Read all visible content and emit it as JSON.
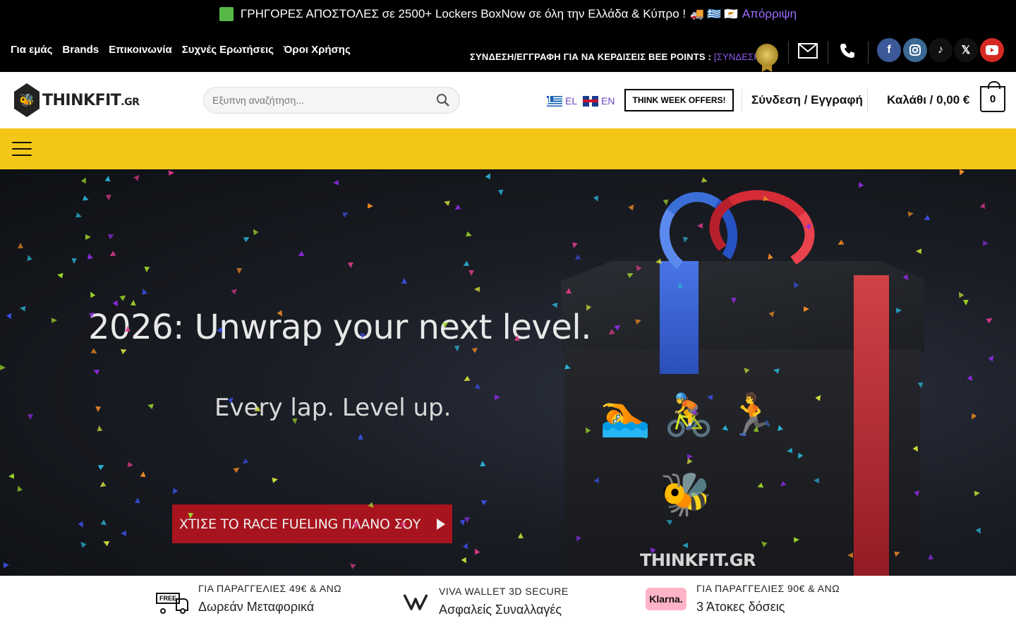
{
  "announcement": {
    "text": "ΓΡΗΓΟΡΕΣ ΑΠΟΣΤΟΛΕΣ σε 2500+ Lockers  BoxNow σε όλη την Ελλάδα & Κύπρο !",
    "dismiss": "Απόρριψη",
    "icons": [
      "green-square",
      "truck-emoji",
      "greek-flag-emoji",
      "cyprus-flag-emoji"
    ]
  },
  "topnav": {
    "items": [
      "Για εμάς",
      "Brands",
      "Επικοινωνία",
      "Συχνές Ερωτήσεις",
      "Όροι Χρήσης"
    ]
  },
  "bee_points": {
    "text": "ΣΥΝΔΕΣΗ/ΕΓΓΡΑΦΗ ΓΙΑ ΝΑ ΚΕΡΔΙΣΕΙΣ BEE  POINTS :",
    "login": "[ΣΥΝΔΕΣΗ]",
    "badge": "BEE POINTS"
  },
  "social": {
    "colors": {
      "facebook": "#3b5998",
      "instagram": "#3b6994",
      "tiktok": "#111111",
      "x": "#111111",
      "youtube": "#d42a22"
    }
  },
  "header": {
    "logo_text": "THINKFIT",
    "logo_suffix": ".GR",
    "search_placeholder": "Εξυπνη αναζήτηση...",
    "lang_el": "EL",
    "lang_en": "EN",
    "week_offers": "THINK WEEK OFFERS!",
    "login": "Σύνδεση / Εγγραφή",
    "cart": "Καλάθι / 0,00 €",
    "cart_count": "0"
  },
  "hero": {
    "title": "2026: Unwrap your next level.",
    "subtitle": "Every lap. Level up.",
    "cta": "ΧΤΙΣΕ ΤΟ RACE  FUELING ΠΛΑΝΟ ΣΟΥ",
    "box_text": "THINKFIT.GR"
  },
  "features": [
    {
      "small": "ΓΙΑ ΠΑΡΑΓΓΕΛΙΕΣ 49€ & ΑΝΩ",
      "big": "Δωρεάν Μεταφορικά",
      "icon": "FREE"
    },
    {
      "small": "VIVA WALLET 3D SECURE",
      "big": "Ασφαλείς Συναλλαγές",
      "icon": "viva-wallet-logo"
    },
    {
      "small": "ΓΙΑ ΠΑΡΑΓΓΕΛΙΕΣ 90€ & ΑΝΩ",
      "big": "3 Άτοκες δόσεις",
      "icon": "Klarna."
    }
  ],
  "colors": {
    "brand_yellow": "#f4c717",
    "accent_purple": "#8b5cf6",
    "cta_red": "#a8141e"
  }
}
